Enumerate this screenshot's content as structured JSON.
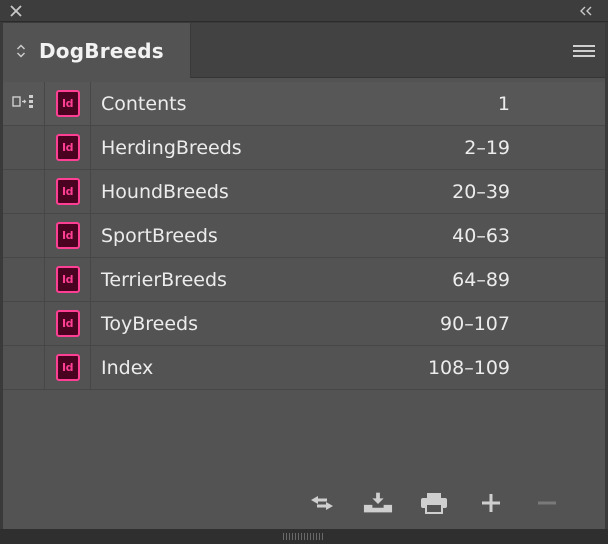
{
  "panel": {
    "tab_title": "DogBreeds"
  },
  "documents": [
    {
      "name": "Contents",
      "pages": "1",
      "style_source": true
    },
    {
      "name": "HerdingBreeds",
      "pages": "2–19"
    },
    {
      "name": "HoundBreeds",
      "pages": "20–39"
    },
    {
      "name": "SportBreeds",
      "pages": "40–63"
    },
    {
      "name": "TerrierBreeds",
      "pages": "64–89"
    },
    {
      "name": "ToyBreeds",
      "pages": "90–107"
    },
    {
      "name": "Index",
      "pages": "108–109"
    }
  ],
  "doc_icon_label": "Id",
  "icons": {
    "close": "close-icon",
    "collapse": "double-chevron-left-icon",
    "tab": "updown-arrows-icon",
    "menu": "hamburger-menu-icon",
    "style_source": "style-source-icon",
    "footer": [
      "synchronize-icon",
      "save-icon",
      "print-icon",
      "add-icon",
      "remove-icon"
    ]
  },
  "colors": {
    "panel_bg": "#535353",
    "indesign_pink": "#ff3f94",
    "indesign_dark": "#49021f"
  }
}
